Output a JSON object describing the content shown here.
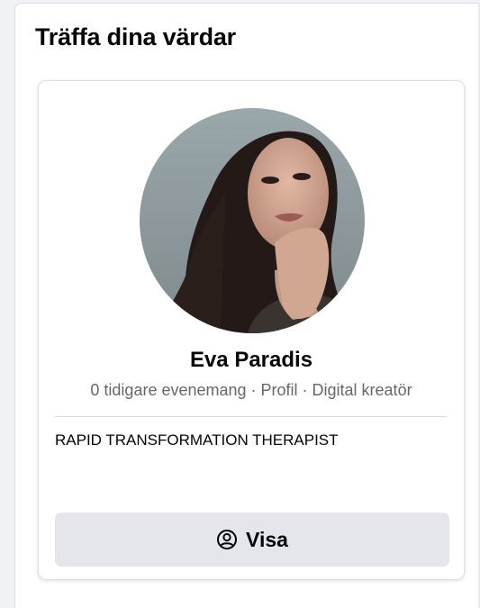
{
  "section": {
    "title": "Träffa dina värdar"
  },
  "host": {
    "name": "Eva Paradis",
    "meta": "0 tidigare evenemang · Profil · Digital kreatör",
    "bio": "RAPID TRANSFORMATION THERAPIST",
    "avatar_icon": "profile-photo"
  },
  "action": {
    "view_label": "Visa",
    "view_icon": "user-circle-icon"
  },
  "colors": {
    "background": "#f0f2f5",
    "card": "#ffffff",
    "button": "#e4e6eb",
    "text_primary": "#050505",
    "text_secondary": "#65676b"
  }
}
